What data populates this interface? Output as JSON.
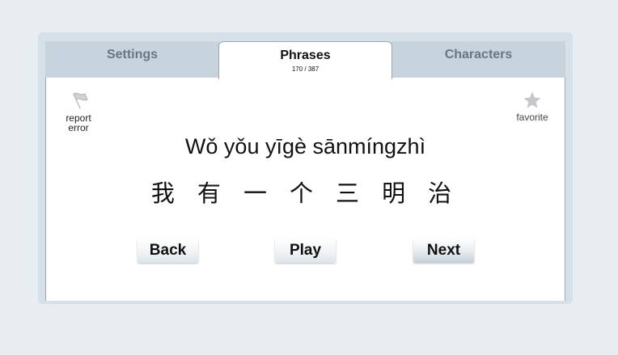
{
  "tabs": [
    {
      "label": "Settings",
      "active": false
    },
    {
      "label": "Phrases",
      "count": "170 / 387",
      "active": true
    },
    {
      "label": "Characters",
      "active": false
    }
  ],
  "report": {
    "label_line1": "report",
    "label_line2": "error",
    "icon": "flag-icon"
  },
  "favorite": {
    "label": "favorite",
    "icon": "star-icon"
  },
  "phrase": {
    "pinyin": "Wǒ yǒu yīgè sānmíngzhì",
    "hanzi": "我 有 一 个 三 明 治"
  },
  "controls": {
    "back": "Back",
    "play": "Play",
    "next": "Next"
  }
}
